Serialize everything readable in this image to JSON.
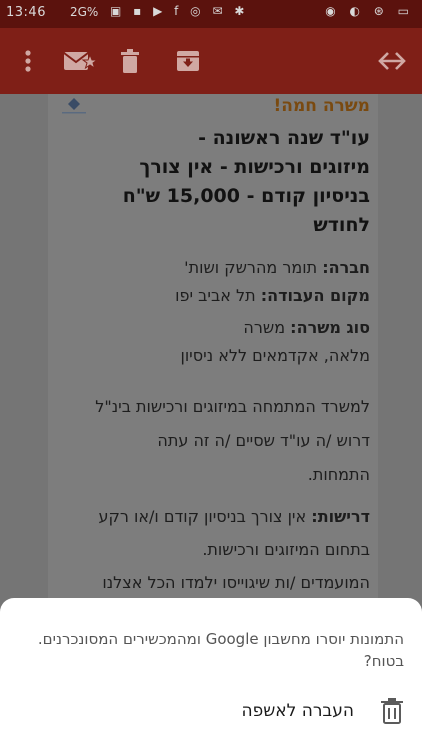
{
  "status_bar": {
    "time": "13:46",
    "network": "2G%",
    "icons": [
      "image-icon",
      "square-icon",
      "youtube-icon",
      "facebook-icon",
      "whatsapp-icon",
      "chat-icon",
      "bluetooth-icon"
    ],
    "right_icons": [
      "vibrate-icon",
      "wifi-icon",
      "sync-icon",
      "battery-icon"
    ]
  },
  "toolbar": {
    "actions": [
      "more-vert-icon",
      "mark-unread-icon",
      "delete-icon",
      "archive-icon",
      "move-icon"
    ]
  },
  "email": {
    "heading": "משרה חמה!",
    "title_lines": [
      "עו\"ד שנה ראשונה -",
      "מיזוגים ורכישות - אין צורך",
      "בניסיון קודם - 15,000 ש\"ח",
      "לחודש"
    ],
    "company_label": "חברה:",
    "company_value": "תומר מהרשק ושות'",
    "location_label": "מקום העבודה:",
    "location_value": "תל אביב יפו",
    "type_label": "סוג משרה:",
    "type_value": "משרה",
    "type_value_2": "מלאה, אקדמאים ללא ניסיון",
    "para1_line1": "למשרד המתמחה במיזוגים ורכישות בינ\"ל",
    "para1_line2": "דרוש /ה עו\"ד  שסיים /ה זה עתה",
    "para1_line3": "התמחות.",
    "req_label": "דרישות:",
    "req_value": "אין צורך בניסיון קודם ו/או רקע",
    "req_line2": "בתחום המיזוגים ורכישות.",
    "req_line3": "המועמדים /ות שיגוייסו ילמדו הכל אצלנו"
  },
  "sheet": {
    "message": "התמונות יוסרו מחשבון Google ומהמכשירים המסונכרנים. בטוח?",
    "action_label": "העברה לאשפה"
  },
  "colors": {
    "toolbar": "#7f1f17",
    "status": "#5b120d",
    "sheet": "#ffffff"
  }
}
